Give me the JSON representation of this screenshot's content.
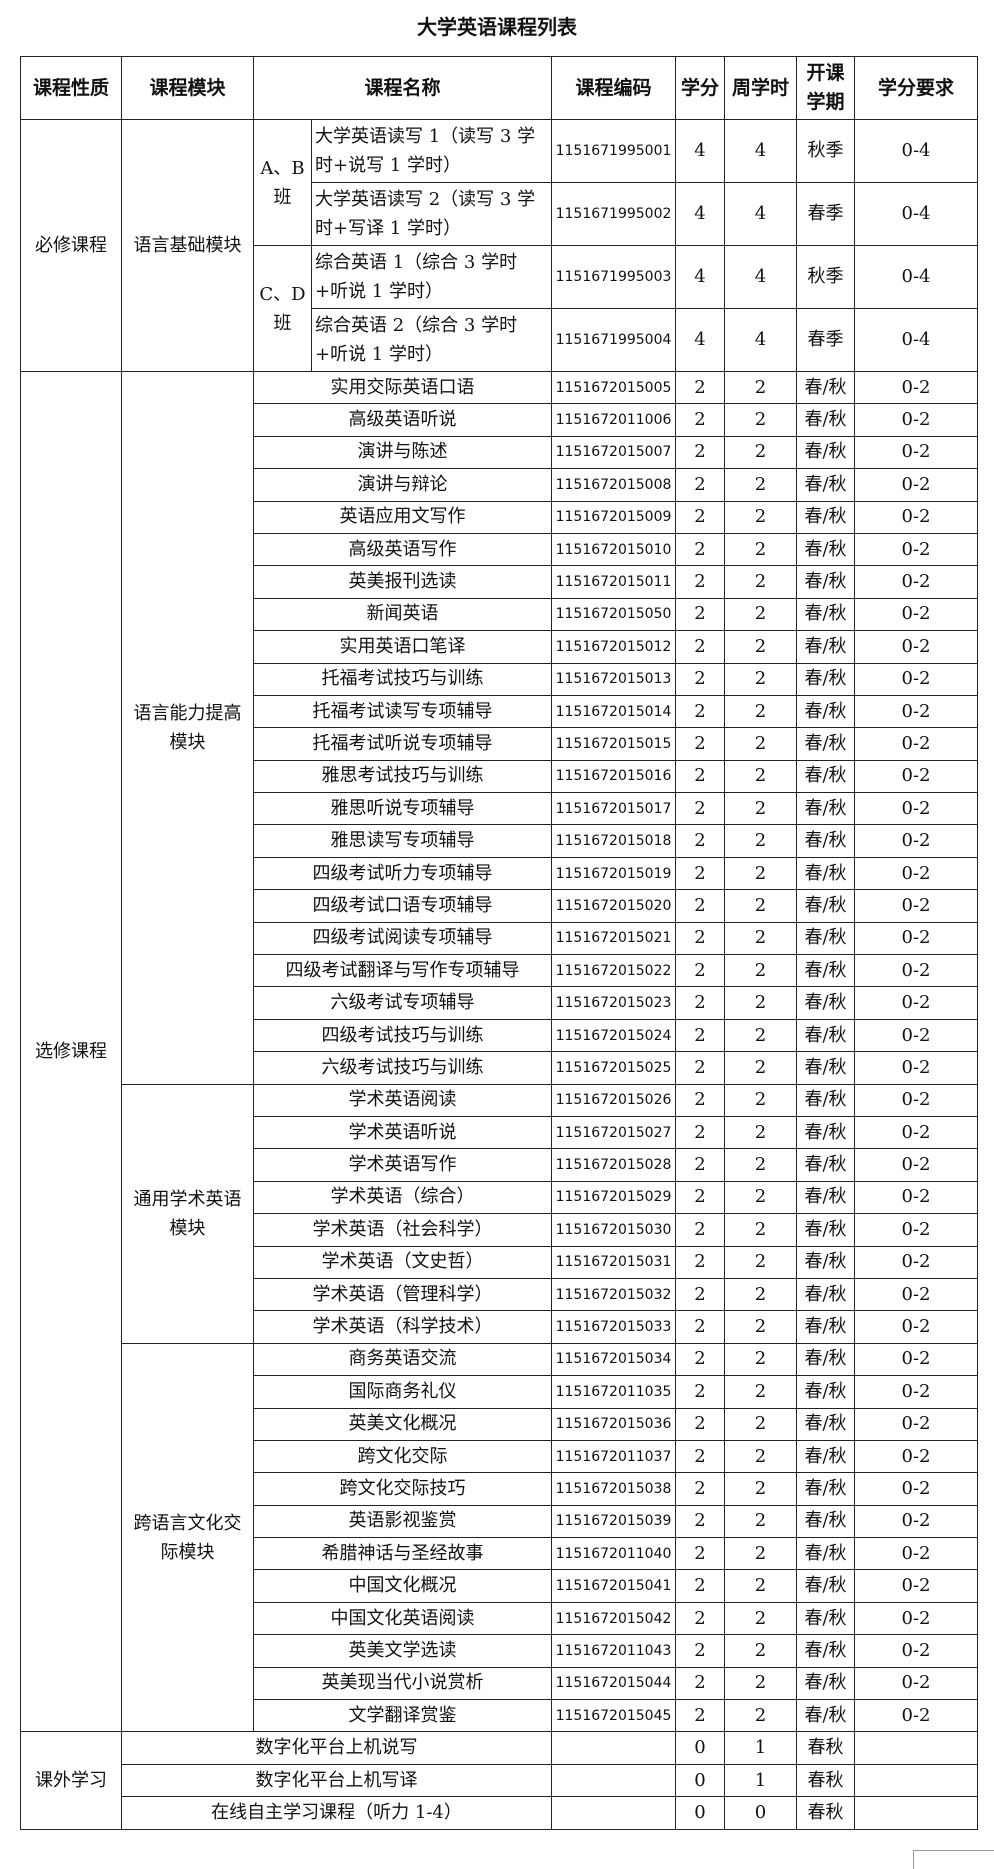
{
  "title": "大学英语课程列表",
  "headers": [
    "课程性质",
    "课程模块",
    "课程名称",
    "课程编码",
    "学分",
    "周学时",
    "开课学期",
    "学分要求"
  ],
  "required": {
    "nature": "必修课程",
    "module": "语言基础模块",
    "groups": [
      {
        "class": "A、B班",
        "rows": [
          {
            "name": "大学英语读写 1（读写 3 学时+说写 1 学时）",
            "code": "1151671995001",
            "credit": "4",
            "hours": "4",
            "term": "秋季",
            "req": "0-4"
          },
          {
            "name": "大学英语读写 2（读写 3 学时+写译 1 学时）",
            "code": "1151671995002",
            "credit": "4",
            "hours": "4",
            "term": "春季",
            "req": "0-4"
          }
        ]
      },
      {
        "class": "C、D班",
        "rows": [
          {
            "name": "综合英语 1（综合 3 学时+听说 1 学时）",
            "code": "1151671995003",
            "credit": "4",
            "hours": "4",
            "term": "秋季",
            "req": "0-4"
          },
          {
            "name": "综合英语 2（综合 3 学时+听说 1 学时）",
            "code": "1151671995004",
            "credit": "4",
            "hours": "4",
            "term": "春季",
            "req": "0-4"
          }
        ]
      }
    ]
  },
  "elective": {
    "nature": "选修课程",
    "modules": [
      {
        "name": "语言能力提高模块",
        "rows": [
          {
            "name": "实用交际英语口语",
            "code": "1151672015005",
            "credit": "2",
            "hours": "2",
            "term": "春/秋",
            "req": "0-2"
          },
          {
            "name": "高级英语听说",
            "code": "1151672011006",
            "credit": "2",
            "hours": "2",
            "term": "春/秋",
            "req": "0-2"
          },
          {
            "name": "演讲与陈述",
            "code": "1151672015007",
            "credit": "2",
            "hours": "2",
            "term": "春/秋",
            "req": "0-2"
          },
          {
            "name": "演讲与辩论",
            "code": "1151672015008",
            "credit": "2",
            "hours": "2",
            "term": "春/秋",
            "req": "0-2"
          },
          {
            "name": "英语应用文写作",
            "code": "1151672015009",
            "credit": "2",
            "hours": "2",
            "term": "春/秋",
            "req": "0-2"
          },
          {
            "name": "高级英语写作",
            "code": "1151672015010",
            "credit": "2",
            "hours": "2",
            "term": "春/秋",
            "req": "0-2"
          },
          {
            "name": "英美报刊选读",
            "code": "1151672015011",
            "credit": "2",
            "hours": "2",
            "term": "春/秋",
            "req": "0-2"
          },
          {
            "name": "新闻英语",
            "code": "1151672015050",
            "credit": "2",
            "hours": "2",
            "term": "春/秋",
            "req": "0-2"
          },
          {
            "name": "实用英语口笔译",
            "code": "1151672015012",
            "credit": "2",
            "hours": "2",
            "term": "春/秋",
            "req": "0-2"
          },
          {
            "name": "托福考试技巧与训练",
            "code": "1151672015013",
            "credit": "2",
            "hours": "2",
            "term": "春/秋",
            "req": "0-2"
          },
          {
            "name": "托福考试读写专项辅导",
            "code": "1151672015014",
            "credit": "2",
            "hours": "2",
            "term": "春/秋",
            "req": "0-2"
          },
          {
            "name": "托福考试听说专项辅导",
            "code": "1151672015015",
            "credit": "2",
            "hours": "2",
            "term": "春/秋",
            "req": "0-2"
          },
          {
            "name": "雅思考试技巧与训练",
            "code": "1151672015016",
            "credit": "2",
            "hours": "2",
            "term": "春/秋",
            "req": "0-2"
          },
          {
            "name": "雅思听说专项辅导",
            "code": "1151672015017",
            "credit": "2",
            "hours": "2",
            "term": "春/秋",
            "req": "0-2"
          },
          {
            "name": "雅思读写专项辅导",
            "code": "1151672015018",
            "credit": "2",
            "hours": "2",
            "term": "春/秋",
            "req": "0-2"
          },
          {
            "name": "四级考试听力专项辅导",
            "code": "1151672015019",
            "credit": "2",
            "hours": "2",
            "term": "春/秋",
            "req": "0-2"
          },
          {
            "name": "四级考试口语专项辅导",
            "code": "1151672015020",
            "credit": "2",
            "hours": "2",
            "term": "春/秋",
            "req": "0-2"
          },
          {
            "name": "四级考试阅读专项辅导",
            "code": "1151672015021",
            "credit": "2",
            "hours": "2",
            "term": "春/秋",
            "req": "0-2"
          },
          {
            "name": "四级考试翻译与写作专项辅导",
            "code": "1151672015022",
            "credit": "2",
            "hours": "2",
            "term": "春/秋",
            "req": "0-2"
          },
          {
            "name": "六级考试专项辅导",
            "code": "1151672015023",
            "credit": "2",
            "hours": "2",
            "term": "春/秋",
            "req": "0-2"
          },
          {
            "name": "四级考试技巧与训练",
            "code": "1151672015024",
            "credit": "2",
            "hours": "2",
            "term": "春/秋",
            "req": "0-2"
          },
          {
            "name": "六级考试技巧与训练",
            "code": "1151672015025",
            "credit": "2",
            "hours": "2",
            "term": "春/秋",
            "req": "0-2"
          }
        ]
      },
      {
        "name": "通用学术英语模块",
        "rows": [
          {
            "name": "学术英语阅读",
            "code": "1151672015026",
            "credit": "2",
            "hours": "2",
            "term": "春/秋",
            "req": "0-2"
          },
          {
            "name": "学术英语听说",
            "code": "1151672015027",
            "credit": "2",
            "hours": "2",
            "term": "春/秋",
            "req": "0-2"
          },
          {
            "name": "学术英语写作",
            "code": "1151672015028",
            "credit": "2",
            "hours": "2",
            "term": "春/秋",
            "req": "0-2"
          },
          {
            "name": "学术英语（综合）",
            "code": "1151672015029",
            "credit": "2",
            "hours": "2",
            "term": "春/秋",
            "req": "0-2"
          },
          {
            "name": "学术英语（社会科学）",
            "code": "1151672015030",
            "credit": "2",
            "hours": "2",
            "term": "春/秋",
            "req": "0-2"
          },
          {
            "name": "学术英语（文史哲）",
            "code": "1151672015031",
            "credit": "2",
            "hours": "2",
            "term": "春/秋",
            "req": "0-2"
          },
          {
            "name": "学术英语（管理科学）",
            "code": "1151672015032",
            "credit": "2",
            "hours": "2",
            "term": "春/秋",
            "req": "0-2"
          },
          {
            "name": "学术英语（科学技术）",
            "code": "1151672015033",
            "credit": "2",
            "hours": "2",
            "term": "春/秋",
            "req": "0-2"
          }
        ]
      },
      {
        "name": "跨语言文化交际模块",
        "rows": [
          {
            "name": "商务英语交流",
            "code": "1151672015034",
            "credit": "2",
            "hours": "2",
            "term": "春/秋",
            "req": "0-2"
          },
          {
            "name": "国际商务礼仪",
            "code": "1151672011035",
            "credit": "2",
            "hours": "2",
            "term": "春/秋",
            "req": "0-2"
          },
          {
            "name": "英美文化概况",
            "code": "1151672015036",
            "credit": "2",
            "hours": "2",
            "term": "春/秋",
            "req": "0-2"
          },
          {
            "name": "跨文化交际",
            "code": "1151672011037",
            "credit": "2",
            "hours": "2",
            "term": "春/秋",
            "req": "0-2"
          },
          {
            "name": "跨文化交际技巧",
            "code": "1151672015038",
            "credit": "2",
            "hours": "2",
            "term": "春/秋",
            "req": "0-2"
          },
          {
            "name": "英语影视鉴赏",
            "code": "1151672015039",
            "credit": "2",
            "hours": "2",
            "term": "春/秋",
            "req": "0-2"
          },
          {
            "name": "希腊神话与圣经故事",
            "code": "1151672011040",
            "credit": "2",
            "hours": "2",
            "term": "春/秋",
            "req": "0-2"
          },
          {
            "name": "中国文化概况",
            "code": "1151672015041",
            "credit": "2",
            "hours": "2",
            "term": "春/秋",
            "req": "0-2"
          },
          {
            "name": "中国文化英语阅读",
            "code": "1151672015042",
            "credit": "2",
            "hours": "2",
            "term": "春/秋",
            "req": "0-2"
          },
          {
            "name": "英美文学选读",
            "code": "1151672011043",
            "credit": "2",
            "hours": "2",
            "term": "春/秋",
            "req": "0-2"
          },
          {
            "name": "英美现当代小说赏析",
            "code": "1151672015044",
            "credit": "2",
            "hours": "2",
            "term": "春/秋",
            "req": "0-2"
          },
          {
            "name": "文学翻译赏鉴",
            "code": "1151672015045",
            "credit": "2",
            "hours": "2",
            "term": "春/秋",
            "req": "0-2"
          }
        ]
      }
    ]
  },
  "extracurricular": {
    "nature": "课外学习",
    "rows": [
      {
        "name": "数字化平台上机说写",
        "code": "",
        "credit": "0",
        "hours": "1",
        "term": "春秋",
        "req": ""
      },
      {
        "name": "数字化平台上机写译",
        "code": "",
        "credit": "0",
        "hours": "1",
        "term": "春秋",
        "req": ""
      },
      {
        "name": "在线自主学习课程（听力 1-4）",
        "code": "",
        "credit": "0",
        "hours": "0",
        "term": "春秋",
        "req": ""
      }
    ]
  }
}
